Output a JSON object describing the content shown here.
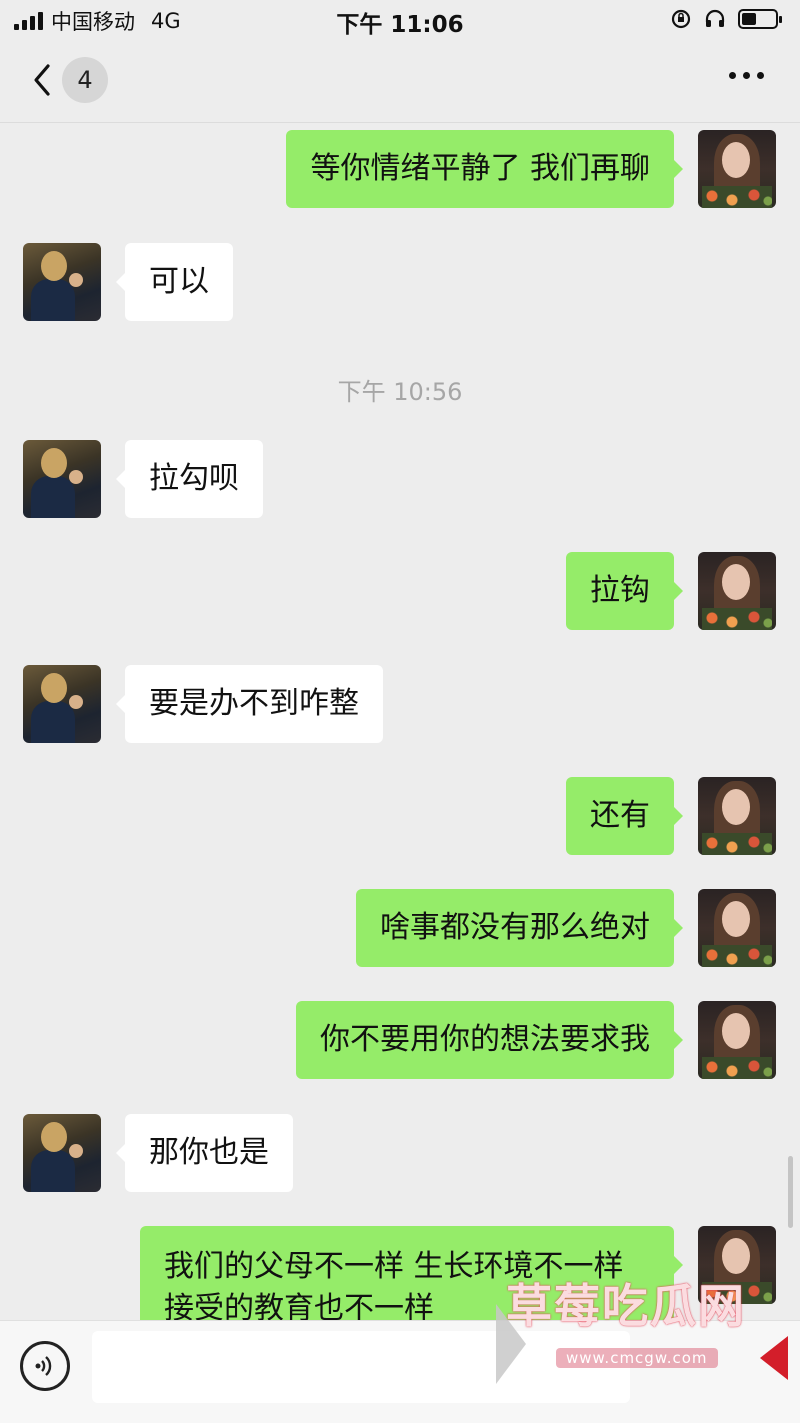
{
  "status": {
    "carrier": "中国移动",
    "network": "4G",
    "time": "下午 11:06"
  },
  "nav": {
    "back_count": "4"
  },
  "messages": {
    "m1": "等你情绪平静了 我们再聊",
    "m2": "可以",
    "timestamp": "下午 10:56",
    "m3": "拉勾呗",
    "m4": "拉钩",
    "m5": "要是办不到咋整",
    "m6": "还有",
    "m7": "啥事都没有那么绝对",
    "m8": "你不要用你的想法要求我",
    "m9": "那你也是",
    "m10": "我们的父母不一样 生长环境不一样 接受的教育也不一样"
  },
  "input": {
    "value": ""
  },
  "watermark": {
    "text": "草莓吃瓜网",
    "url": "www.cmcgw.com"
  },
  "colors": {
    "sent_bubble": "#95ec69",
    "received_bubble": "#ffffff",
    "background": "#ededed"
  }
}
